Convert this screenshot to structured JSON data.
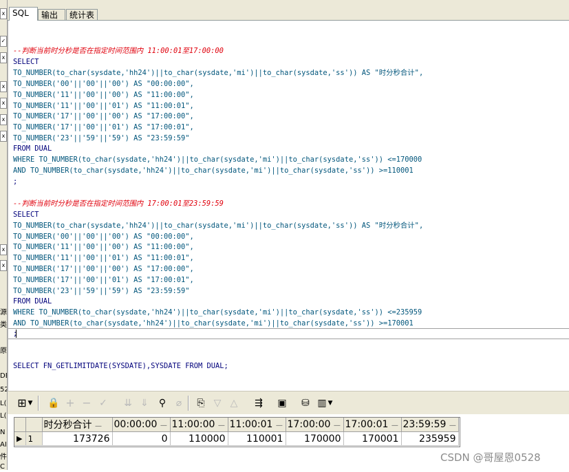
{
  "tabs": [
    "SQL",
    "输出",
    "统计表"
  ],
  "left_strip": {
    "buttons": [
      "x",
      "✓",
      "x",
      "x",
      "x",
      "x",
      "x",
      "x",
      "x"
    ],
    "chars": [
      "源",
      "类",
      "原",
      "DE",
      "52",
      "L(I",
      "L(I",
      "N",
      "AI",
      "件",
      "C"
    ]
  },
  "editor": {
    "block1": {
      "comment": "--判断当前时分秒是否在指定时间范围内 11:00:01至17:00:00",
      "select": "SELECT",
      "line_total_a": "TO_NUMBER(to_char(sysdate,'hh24')||to_char(sysdate,'mi')||to_char(sysdate,'ss')) AS \"时分秒合计\",",
      "cols": [
        "TO_NUMBER('00'||'00'||'00') AS \"00:00:00\",",
        "TO_NUMBER('11'||'00'||'00') AS \"11:00:00\",",
        "TO_NUMBER('11'||'00'||'01') AS \"11:00:01\",",
        "TO_NUMBER('17'||'00'||'00') AS \"17:00:00\",",
        "TO_NUMBER('17'||'00'||'01') AS \"17:00:01\",",
        "TO_NUMBER('23'||'59'||'59') AS \"23:59:59\""
      ],
      "from": "FROM DUAL",
      "where": "WHERE TO_NUMBER(to_char(sysdate,'hh24')||to_char(sysdate,'mi')||to_char(sysdate,'ss')) <=170000",
      "and": "AND TO_NUMBER(to_char(sysdate,'hh24')||to_char(sysdate,'mi')||to_char(sysdate,'ss')) >=110001",
      "end": ";"
    },
    "block2": {
      "comment": "--判断当前时分秒是否在指定时间范围内 17:00:01至23:59:59",
      "select": "SELECT",
      "line_total_a": "TO_NUMBER(to_char(sysdate,'hh24')||to_char(sysdate,'mi')||to_char(sysdate,'ss')) AS \"时分秒合计\",",
      "cols": [
        "TO_NUMBER('00'||'00'||'00') AS \"00:00:00\",",
        "TO_NUMBER('11'||'00'||'00') AS \"11:00:00\",",
        "TO_NUMBER('11'||'00'||'01') AS \"11:00:01\",",
        "TO_NUMBER('17'||'00'||'00') AS \"17:00:00\",",
        "TO_NUMBER('17'||'00'||'01') AS \"17:00:01\",",
        "TO_NUMBER('23'||'59'||'59') AS \"23:59:59\""
      ],
      "from": "FROM DUAL",
      "where": "WHERE TO_NUMBER(to_char(sysdate,'hh24')||to_char(sysdate,'mi')||to_char(sysdate,'ss')) <=235959",
      "and": "AND TO_NUMBER(to_char(sysdate,'hh24')||to_char(sysdate,'mi')||to_char(sysdate,'ss')) >=170001",
      "end": ";"
    },
    "last_query": "SELECT FN_GETLIMITDATE(SYSDATE),SYSDATE FROM DUAL;"
  },
  "toolbar": {
    "icons": [
      "grid-icon",
      "lock-icon",
      "add-icon",
      "remove-icon",
      "check-icon",
      "down-icon",
      "down-all-icon",
      "find-icon",
      "clear-icon",
      "export-icon",
      "triangle-down-icon",
      "triangle-up-icon",
      "sql-icon",
      "save-icon",
      "db-icon",
      "chart-icon"
    ]
  },
  "results": {
    "columns": [
      "时分秒合计",
      "00:00:00",
      "11:00:00",
      "11:00:01",
      "17:00:00",
      "17:00:01",
      "23:59:59"
    ],
    "rows": [
      {
        "indicator": "▶",
        "num": "1",
        "cells": [
          "173726",
          "0",
          "110000",
          "110001",
          "170000",
          "170001",
          "235959"
        ]
      }
    ]
  },
  "watermark": "CSDN @哥屋恩0528"
}
